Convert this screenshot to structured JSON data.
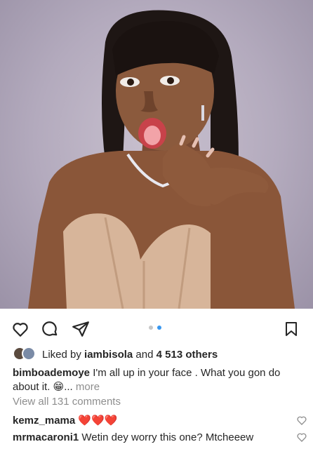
{
  "post": {
    "image_icon": "portrait-photo",
    "carousel": {
      "count": 2,
      "active": 2
    }
  },
  "actions": {
    "like_icon": "heart-icon",
    "comment_icon": "comment-icon",
    "share_icon": "send-icon",
    "save_icon": "bookmark-icon"
  },
  "likes": {
    "prefix": "Liked by",
    "user": "iambisola",
    "and": "and",
    "others": "4 513 others"
  },
  "caption": {
    "username": "bimboademoye",
    "text": "I'm all up in your face . What you gon do about it.",
    "emoji": "😁",
    "ellipsis": "...",
    "more": "more"
  },
  "view_comments": "View all 131 comments",
  "comments": [
    {
      "username": "kemz_mama",
      "text": "❤️❤️❤️"
    },
    {
      "username": "mrmacaroni1",
      "text": "Wetin dey worry this one? Mtcheeew"
    }
  ],
  "colors": {
    "accent": "#3897f0",
    "muted": "#8e8e8e",
    "text": "#262626"
  }
}
